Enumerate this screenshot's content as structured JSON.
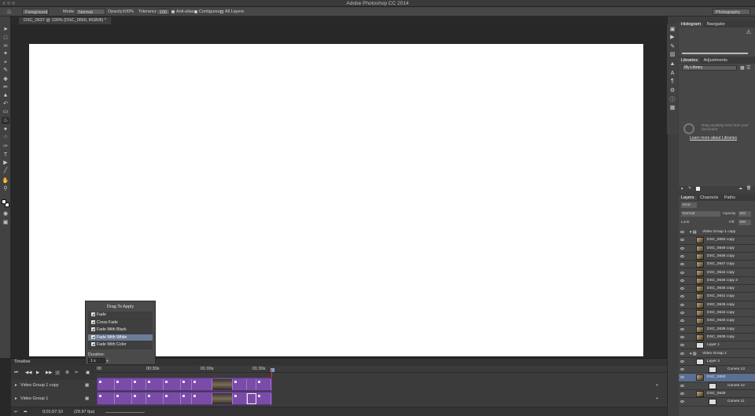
{
  "app": {
    "title": "Adobe Photoshop CC 2014",
    "workspace": "Photography"
  },
  "options": {
    "source_value": "Foreground",
    "mode_label": "Mode:",
    "mode_value": "Normal",
    "opacity_label": "Opacity:",
    "opacity_value": "100%",
    "tolerance_label": "Tolerance:",
    "tolerance_value": "100",
    "antialias": "Anti-alias",
    "contiguous": "Contiguous",
    "all_layers": "All Layers"
  },
  "document": {
    "tab_label": "DSC_0637 @ 100% (DSC_0650, RGB/8) *"
  },
  "transitions": {
    "header": "Drag To Apply",
    "items": [
      "Fade",
      "Cross Fade",
      "Fade With Black",
      "Fade With White",
      "Fade With Color"
    ],
    "selected": "Fade With White",
    "duration_label": "Duration:",
    "duration_value": "1 s"
  },
  "timeline": {
    "panel_label": "Timeline",
    "ruler": [
      "00",
      "00:30s",
      "01:00s",
      "01:30s"
    ],
    "tracks": [
      "Video Group 1 copy",
      "Video Group 1"
    ],
    "timecode": "0;01;57;10",
    "fps": "(29.97 fps)"
  },
  "histogram": {
    "tabs": [
      "Histogram",
      "Navigator"
    ]
  },
  "libraries": {
    "tabs": [
      "Libraries",
      "Adjustments"
    ],
    "selected": "My Library",
    "hint": "Drag anything here from your document",
    "link": "Learn more about Libraries"
  },
  "layers": {
    "tabs": [
      "Layers",
      "Channels",
      "Paths"
    ],
    "filter": "Kind",
    "blend": "Normal",
    "opacity_label": "Opacity:",
    "opacity_value": "100",
    "lock_label": "Lock:",
    "fill_label": "Fill:",
    "fill_value": "100",
    "rows": [
      "Video Group 1 copy",
      "DSC_0650 copy",
      "DSC_0649 copy",
      "DSC_0648 copy",
      "DSC_0647 copy",
      "DSC_0642 copy",
      "DSC_0646 copy 2",
      "DSC_0646 copy",
      "DSC_0641 copy",
      "DSC_0645 copy",
      "DSC_0643 copy",
      "DSC_0640 copy",
      "DSC_0638 copy",
      "DSC_0639 copy",
      "Layer 1",
      "Video Group 1",
      "Layer 2",
      "Curves 13",
      "DSC_0650",
      "Curves 12",
      "DSC_0649",
      "Curves 11"
    ],
    "selected_row": "DSC_0650"
  }
}
